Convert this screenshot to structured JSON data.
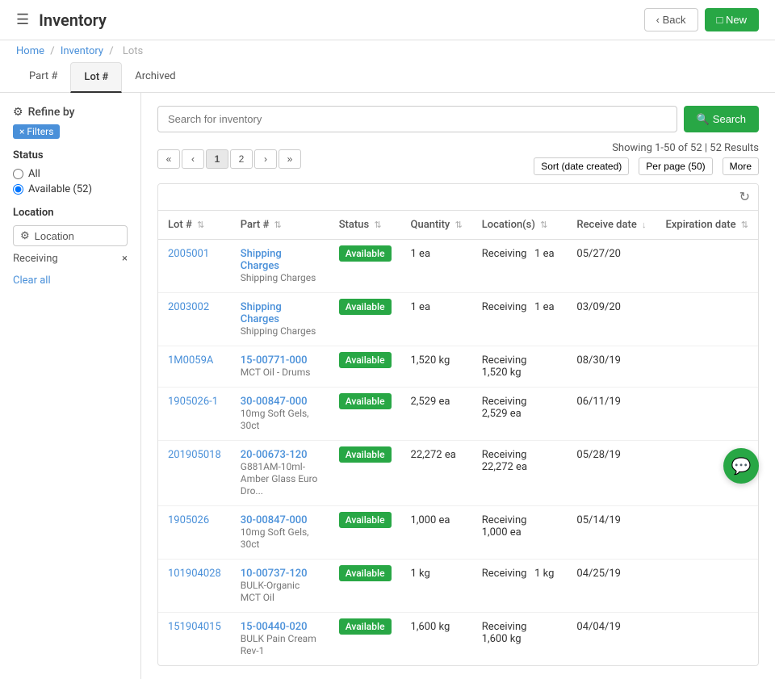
{
  "header": {
    "hamburger": "☰",
    "title": "Inventory",
    "back_label": "‹ Back",
    "new_label": "□ New"
  },
  "breadcrumb": {
    "home": "Home",
    "inventory": "Inventory",
    "lots": "Lots",
    "sep": "/"
  },
  "tabs": [
    {
      "id": "part",
      "label": "Part #"
    },
    {
      "id": "lot",
      "label": "Lot #",
      "active": true
    },
    {
      "id": "archived",
      "label": "Archived"
    }
  ],
  "sidebar": {
    "refine_label": "Refine by",
    "filters_badge": "× Filters",
    "status": {
      "title": "Status",
      "options": [
        {
          "label": "All",
          "checked": false
        },
        {
          "label": "Available (52)",
          "checked": true
        }
      ]
    },
    "location": {
      "title": "Location",
      "button_label": "Location"
    },
    "receiving_label": "Receiving",
    "close_icon": "×",
    "clear_all": "Clear all"
  },
  "search": {
    "placeholder": "Search for inventory",
    "button_label": "Search"
  },
  "pagination": {
    "first": "«",
    "prev": "‹",
    "pages": [
      "1",
      "2"
    ],
    "next": "›",
    "last": "»",
    "current": "1",
    "showing": "Showing 1-50 of 52 | 52 Results",
    "sort_label": "Sort (date created)",
    "per_page_label": "Per page (50)",
    "more_label": "More"
  },
  "table": {
    "refresh_icon": "↻",
    "columns": [
      "Lot #",
      "Part #",
      "Status",
      "Quantity",
      "Location(s)",
      "Receive date",
      "Expiration date"
    ],
    "rows": [
      {
        "lot": "2005001",
        "part_num": "Shipping Charges",
        "part_sub": "Shipping Charges",
        "status": "Available",
        "quantity": "1 ea",
        "location": "Receiving",
        "loc_qty": "1 ea",
        "receive_date": "05/27/20",
        "exp_date": ""
      },
      {
        "lot": "2003002",
        "part_num": "Shipping Charges",
        "part_sub": "Shipping Charges",
        "status": "Available",
        "quantity": "1 ea",
        "location": "Receiving",
        "loc_qty": "1 ea",
        "receive_date": "03/09/20",
        "exp_date": ""
      },
      {
        "lot": "1M0059A",
        "part_num": "15-00771-000",
        "part_sub": "MCT Oil - Drums",
        "status": "Available",
        "quantity": "1,520 kg",
        "location": "Receiving",
        "loc_qty": "1,520 kg",
        "receive_date": "08/30/19",
        "exp_date": ""
      },
      {
        "lot": "1905026-1",
        "part_num": "30-00847-000",
        "part_sub": "10mg Soft Gels, 30ct",
        "status": "Available",
        "quantity": "2,529 ea",
        "location": "Receiving",
        "loc_qty": "2,529 ea",
        "receive_date": "06/11/19",
        "exp_date": ""
      },
      {
        "lot": "201905018",
        "part_num": "20-00673-120",
        "part_sub": "G881AM-10ml-Amber Glass Euro Dro...",
        "status": "Available",
        "quantity": "22,272 ea",
        "location": "Receiving",
        "loc_qty": "22,272 ea",
        "receive_date": "05/28/19",
        "exp_date": ""
      },
      {
        "lot": "1905026",
        "part_num": "30-00847-000",
        "part_sub": "10mg Soft Gels, 30ct",
        "status": "Available",
        "quantity": "1,000 ea",
        "location": "Receiving",
        "loc_qty": "1,000 ea",
        "receive_date": "05/14/19",
        "exp_date": ""
      },
      {
        "lot": "101904028",
        "part_num": "10-00737-120",
        "part_sub": "BULK-Organic MCT Oil",
        "status": "Available",
        "quantity": "1 kg",
        "location": "Receiving",
        "loc_qty": "1 kg",
        "receive_date": "04/25/19",
        "exp_date": ""
      },
      {
        "lot": "151904015",
        "part_num": "15-00440-020",
        "part_sub": "BULK Pain Cream Rev-1",
        "status": "Available",
        "quantity": "1,600 kg",
        "location": "Receiving",
        "loc_qty": "1,600 kg",
        "receive_date": "04/04/19",
        "exp_date": ""
      }
    ]
  },
  "chat": {
    "icon": "💬"
  }
}
